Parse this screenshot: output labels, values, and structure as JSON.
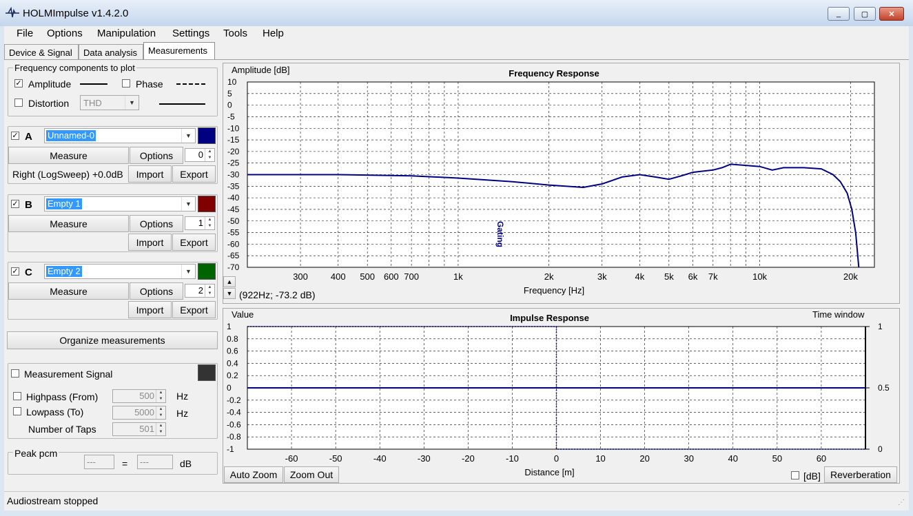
{
  "window": {
    "title": "HOLMImpulse  v1.4.2.0",
    "minimize": "_",
    "maximize": "▢",
    "close": "✕"
  },
  "menu": [
    "File",
    "Options",
    "Manipulation",
    "Settings",
    "Tools",
    "Help"
  ],
  "tabs": [
    "Device & Signal",
    "Data analysis",
    "Measurements"
  ],
  "freq_components": {
    "title": "Frequency components to plot",
    "amplitude": {
      "label": "Amplitude",
      "checked": true
    },
    "phase": {
      "label": "Phase",
      "checked": false
    },
    "distortion": {
      "label": "Distortion",
      "checked": false,
      "value": "THD"
    }
  },
  "slots": [
    {
      "letter": "A",
      "checked": true,
      "name": "Unnamed-0",
      "color": "#000080",
      "measure": "Measure",
      "options": "Options",
      "index": "0",
      "info": "Right (LogSweep) +0.0dB",
      "import": "Import",
      "export": "Export"
    },
    {
      "letter": "B",
      "checked": true,
      "name": "Empty 1",
      "color": "#800000",
      "measure": "Measure",
      "options": "Options",
      "index": "1",
      "info": "",
      "import": "Import",
      "export": "Export"
    },
    {
      "letter": "C",
      "checked": true,
      "name": "Empty 2",
      "color": "#006400",
      "measure": "Measure",
      "options": "Options",
      "index": "2",
      "info": "",
      "import": "Import",
      "export": "Export"
    }
  ],
  "organize": "Organize measurements",
  "signal": {
    "label": "Measurement Signal",
    "checked": false,
    "color": "#333333",
    "highpass": {
      "label": "Highpass (From)",
      "value": "500",
      "unit": "Hz"
    },
    "lowpass": {
      "label": "Lowpass (To)",
      "value": "5000",
      "unit": "Hz"
    },
    "taps": {
      "label": "Number of Taps",
      "value": "501"
    }
  },
  "peak": {
    "label": "Peak pcm",
    "left": "---",
    "eq": "=",
    "right": "---",
    "unit": "dB"
  },
  "freq_plot": {
    "cursor": "(922Hz; -73.2 dB)",
    "up": "▲",
    "down": "▼"
  },
  "imp_plot": {
    "auto_zoom": "Auto Zoom",
    "zoom_out": "Zoom Out",
    "db_label": "[dB]",
    "db_checked": false,
    "reverb": "Reverberation"
  },
  "status": "Audiostream stopped",
  "colors": {
    "curve": "#000080",
    "accent": "#3399ff"
  },
  "chart_data": [
    {
      "type": "line",
      "title": "Frequency Response",
      "ylabel": "Amplitude [dB]",
      "xlabel": "Frequency [Hz]",
      "xscale": "log",
      "xlim": [
        200,
        24000
      ],
      "ylim": [
        -70,
        10
      ],
      "yticks": [
        10,
        5,
        0,
        -5,
        -10,
        -15,
        -20,
        -25,
        -30,
        -35,
        -40,
        -45,
        -50,
        -55,
        -60,
        -65,
        -70
      ],
      "xticks": [
        {
          "v": 300,
          "l": "300"
        },
        {
          "v": 400,
          "l": "400"
        },
        {
          "v": 500,
          "l": "500"
        },
        {
          "v": 600,
          "l": "600"
        },
        {
          "v": 700,
          "l": "700"
        },
        {
          "v": 1000,
          "l": "1k"
        },
        {
          "v": 2000,
          "l": "2k"
        },
        {
          "v": 3000,
          "l": "3k"
        },
        {
          "v": 4000,
          "l": "4k"
        },
        {
          "v": 5000,
          "l": "5k"
        },
        {
          "v": 6000,
          "l": "6k"
        },
        {
          "v": 7000,
          "l": "7k"
        },
        {
          "v": 10000,
          "l": "10k"
        },
        {
          "v": 20000,
          "l": "20k"
        }
      ],
      "grid": true,
      "marker": {
        "label": "Gating",
        "x": 1350
      },
      "series": [
        {
          "x": [
            200,
            400,
            700,
            1000,
            1500,
            2000,
            2600,
            3000,
            3500,
            4000,
            4500,
            5000,
            5500,
            6000,
            7000,
            7500,
            8000,
            9000,
            10000,
            11000,
            12000,
            14000,
            16000,
            17500,
            18500,
            19500,
            20200,
            20800,
            21300
          ],
          "y": [
            -30,
            -30,
            -30.5,
            -31.5,
            -33,
            -34.5,
            -35.5,
            -34,
            -31,
            -30,
            -31,
            -32,
            -30.5,
            -29,
            -28,
            -27,
            -25.5,
            -26,
            -26.5,
            -28,
            -27,
            -27,
            -27.5,
            -30,
            -33,
            -38,
            -45,
            -55,
            -70
          ]
        }
      ]
    },
    {
      "type": "line",
      "title": "Impulse Response",
      "ylabel": "Value",
      "y2label": "Time window",
      "xlabel": "Distance [m]",
      "xlim": [
        -70,
        70
      ],
      "ylim": [
        -1,
        1
      ],
      "yticks": [
        "1",
        "0.8",
        "0.6",
        "0.4",
        "0.2",
        "0",
        "-0.2",
        "-0.4",
        "-0.6",
        "-0.8",
        "-1"
      ],
      "y2ticks": [
        "1",
        "0.5",
        "0"
      ],
      "xticks": [
        -60,
        -50,
        -40,
        -30,
        -20,
        -10,
        0,
        10,
        20,
        30,
        40,
        50,
        60
      ],
      "grid": true,
      "series": [
        {
          "x": [
            -70,
            0,
            0,
            0,
            70
          ],
          "y": [
            0,
            0,
            0.02,
            0,
            0
          ]
        }
      ],
      "window": {
        "x": [
          -70,
          0,
          0,
          70
        ],
        "y": [
          1,
          1,
          -1,
          -1
        ]
      }
    }
  ]
}
